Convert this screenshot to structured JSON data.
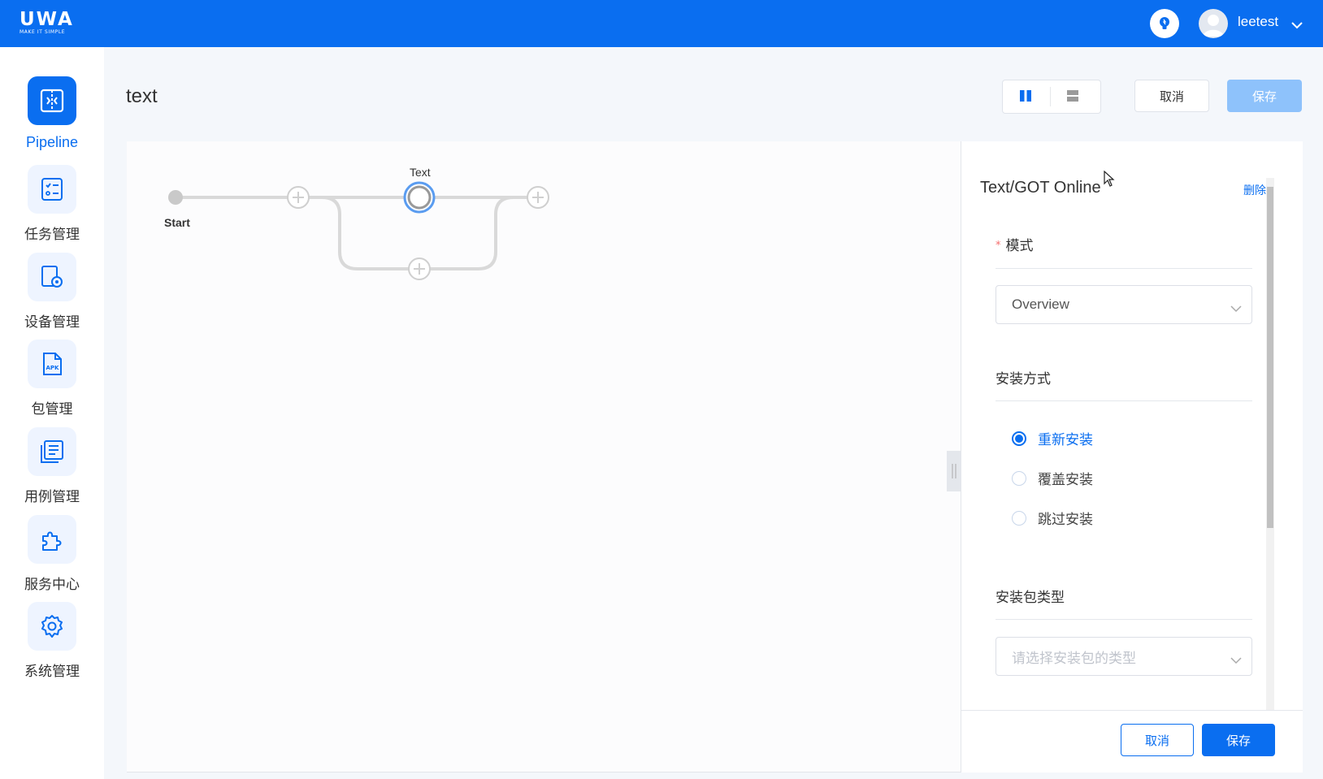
{
  "app": {
    "logo_text": "UWA",
    "logo_tagline": "MAKE IT SIMPLE",
    "username": "leetest",
    "brand_color": "#0a6ef0"
  },
  "sidebar": {
    "items": [
      {
        "label": "Pipeline",
        "icon": "pipeline-icon",
        "active": true
      },
      {
        "label": "任务管理",
        "icon": "task-list-icon"
      },
      {
        "label": "设备管理",
        "icon": "device-settings-icon"
      },
      {
        "label": "包管理",
        "icon": "apk-file-icon"
      },
      {
        "label": "用例管理",
        "icon": "document-list-icon"
      },
      {
        "label": "服务中心",
        "icon": "puzzle-icon"
      },
      {
        "label": "系统管理",
        "icon": "gear-icon"
      }
    ]
  },
  "header": {
    "title": "text",
    "cancel_label": "取消",
    "save_label": "保存"
  },
  "pipeline": {
    "start_label": "Start",
    "node_label": "Text",
    "apk_icon_text": "APK"
  },
  "panel": {
    "title": "Text/GOT Online",
    "delete_label": "删除",
    "mode_label": "模式",
    "mode_value": "Overview",
    "install_method_label": "安装方式",
    "install_options": [
      {
        "label": "重新安装",
        "checked": true
      },
      {
        "label": "覆盖安装",
        "checked": false
      },
      {
        "label": "跳过安装",
        "checked": false
      }
    ],
    "package_type_label": "安装包类型",
    "package_type_placeholder": "请选择安装包的类型",
    "cancel_label": "取消",
    "save_label": "保存"
  }
}
